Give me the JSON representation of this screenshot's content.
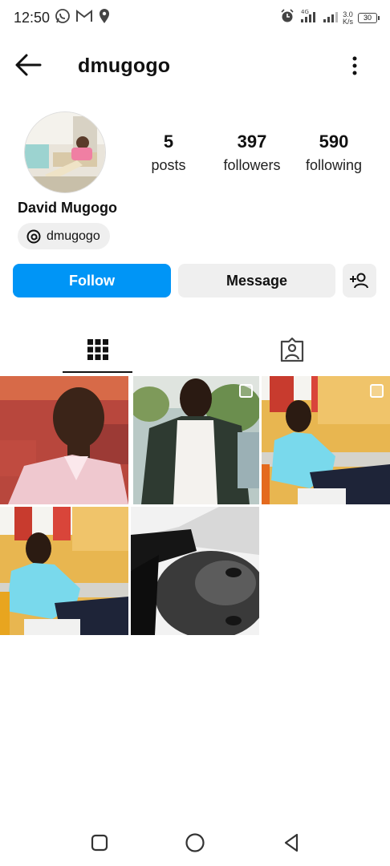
{
  "status_bar": {
    "time": "12:50",
    "left_icons": [
      "whatsapp-icon",
      "gmail-icon",
      "location-icon"
    ],
    "network": "4G",
    "speed_value": "3.0",
    "speed_unit": "K/s",
    "battery": "30"
  },
  "header": {
    "username": "dmugogo",
    "back_icon": "arrow-left-icon",
    "menu_icon": "more-vertical-icon"
  },
  "profile": {
    "display_name": "David Mugogo",
    "threads_handle": "dmugogo",
    "stats": [
      {
        "value": "5",
        "label": "posts"
      },
      {
        "value": "397",
        "label": "followers"
      },
      {
        "value": "590",
        "label": "following"
      }
    ]
  },
  "actions": {
    "follow_label": "Follow",
    "message_label": "Message",
    "add_user_icon": "add-user-icon"
  },
  "tabs": {
    "grid_icon": "grid-icon",
    "tagged_icon": "tagged-icon",
    "active": "grid"
  },
  "posts_count": 5,
  "colors": {
    "accent": "#0095f6",
    "button_gray": "#efefef",
    "text": "#111111"
  },
  "navbar": {
    "icons": [
      "square-recents-icon",
      "circle-home-icon",
      "triangle-back-icon"
    ]
  }
}
